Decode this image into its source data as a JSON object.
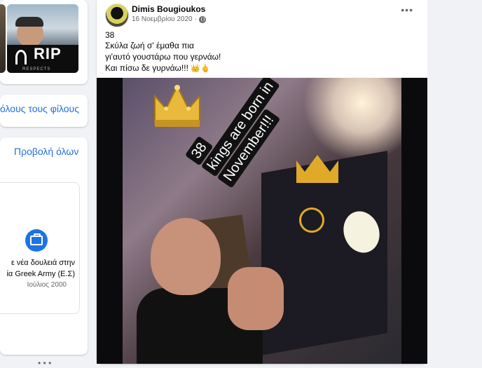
{
  "left_column": {
    "photo_overlay": {
      "rip_text": "RIP",
      "respects_text": "RESPECTS"
    },
    "friends_link": "όλους τους φίλους",
    "life_events": {
      "view_all": "Προβολή όλων",
      "event_line1": "ε νέα δουλειά στην",
      "event_line2": "ία Greek Army (Ε.Σ)",
      "event_date": "Ιούλιος 2000"
    },
    "bottom_marker": "• • •"
  },
  "post": {
    "author": "Dimis Bougioukos",
    "date": "16 Νοεμβρίου 2020",
    "more_label": "•••",
    "text_lines": [
      "38",
      "Σκύλα ζωή σ' έμαθα πια",
      "γι'αυτό γουστάρω που γερνάω!",
      "Και πίσω δε γυρνάω!!!"
    ],
    "line4_emojis": "👑🖕",
    "image_sticker": {
      "line1": "38",
      "line2": "kings are born in",
      "line3": "November!!!"
    }
  },
  "colors": {
    "link": "#216fdb",
    "background": "#f0f2f5",
    "card": "#ffffff",
    "secondary_text": "#65676b",
    "accent": "#1b74e4"
  }
}
